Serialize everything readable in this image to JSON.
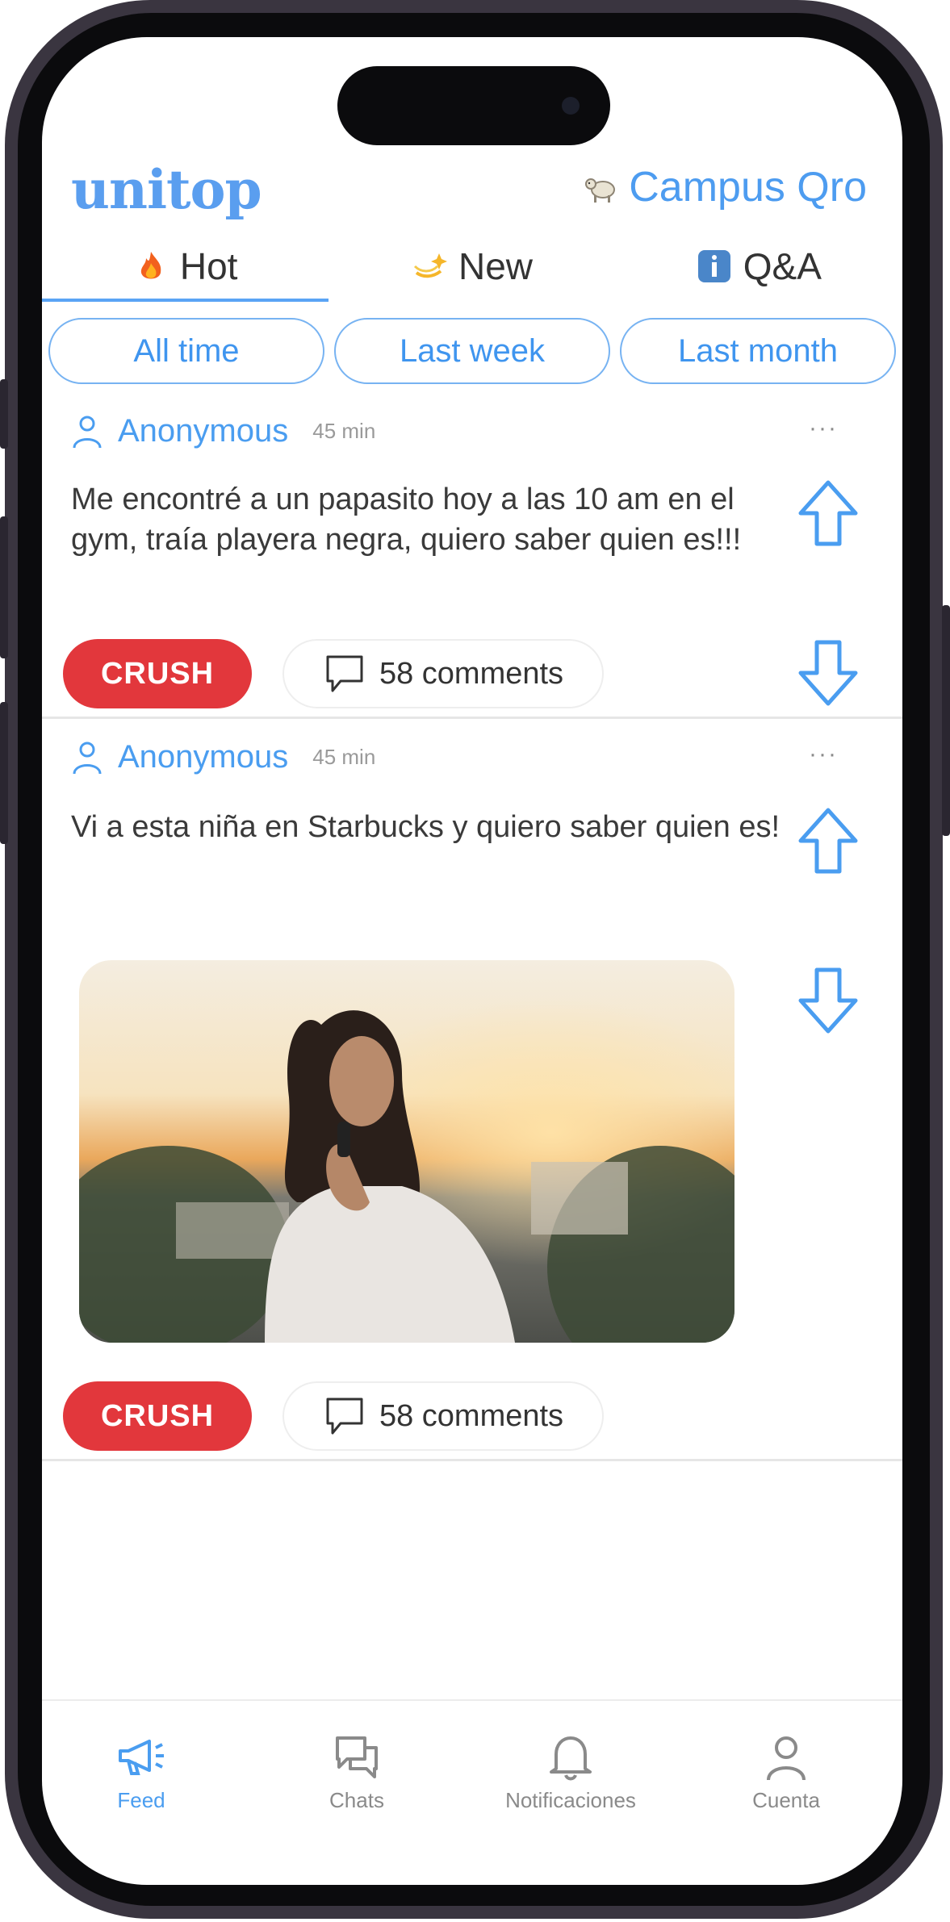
{
  "app": {
    "logo": "unitop",
    "campus": "Campus Qro",
    "campus_icon": "llama-icon"
  },
  "tabs": [
    {
      "label": "Hot",
      "icon": "fire-icon",
      "active": true
    },
    {
      "label": "New",
      "icon": "sparkle-icon",
      "active": false
    },
    {
      "label": "Q&A",
      "icon": "info-icon",
      "active": false
    }
  ],
  "filters": [
    {
      "label": "All time"
    },
    {
      "label": "Last week"
    },
    {
      "label": "Last month"
    }
  ],
  "posts": [
    {
      "author": "Anonymous",
      "time": "45 min",
      "text": "Me encontré a un papasito hoy a las 10 am en el gym, traía playera negra, quiero saber quien es!!!",
      "tag": "CRUSH",
      "comments": "58 comments",
      "more": "···"
    },
    {
      "author": "Anonymous",
      "time": "45 min",
      "text": "Vi a esta niña en Starbucks y quiero saber quien es!",
      "tag": "CRUSH",
      "comments": "58 comments",
      "more": "···",
      "image": "photo of a woman talking on the phone at sunset"
    }
  ],
  "nav": [
    {
      "label": "Feed",
      "icon": "megaphone-icon",
      "active": true
    },
    {
      "label": "Chats",
      "icon": "chat-icon",
      "active": false
    },
    {
      "label": "Notificaciones",
      "icon": "bell-icon",
      "active": false
    },
    {
      "label": "Cuenta",
      "icon": "user-icon",
      "active": false
    }
  ],
  "colors": {
    "accent": "#4a9df0",
    "tag": "#e2373c",
    "frame": "#0b0b0d"
  }
}
